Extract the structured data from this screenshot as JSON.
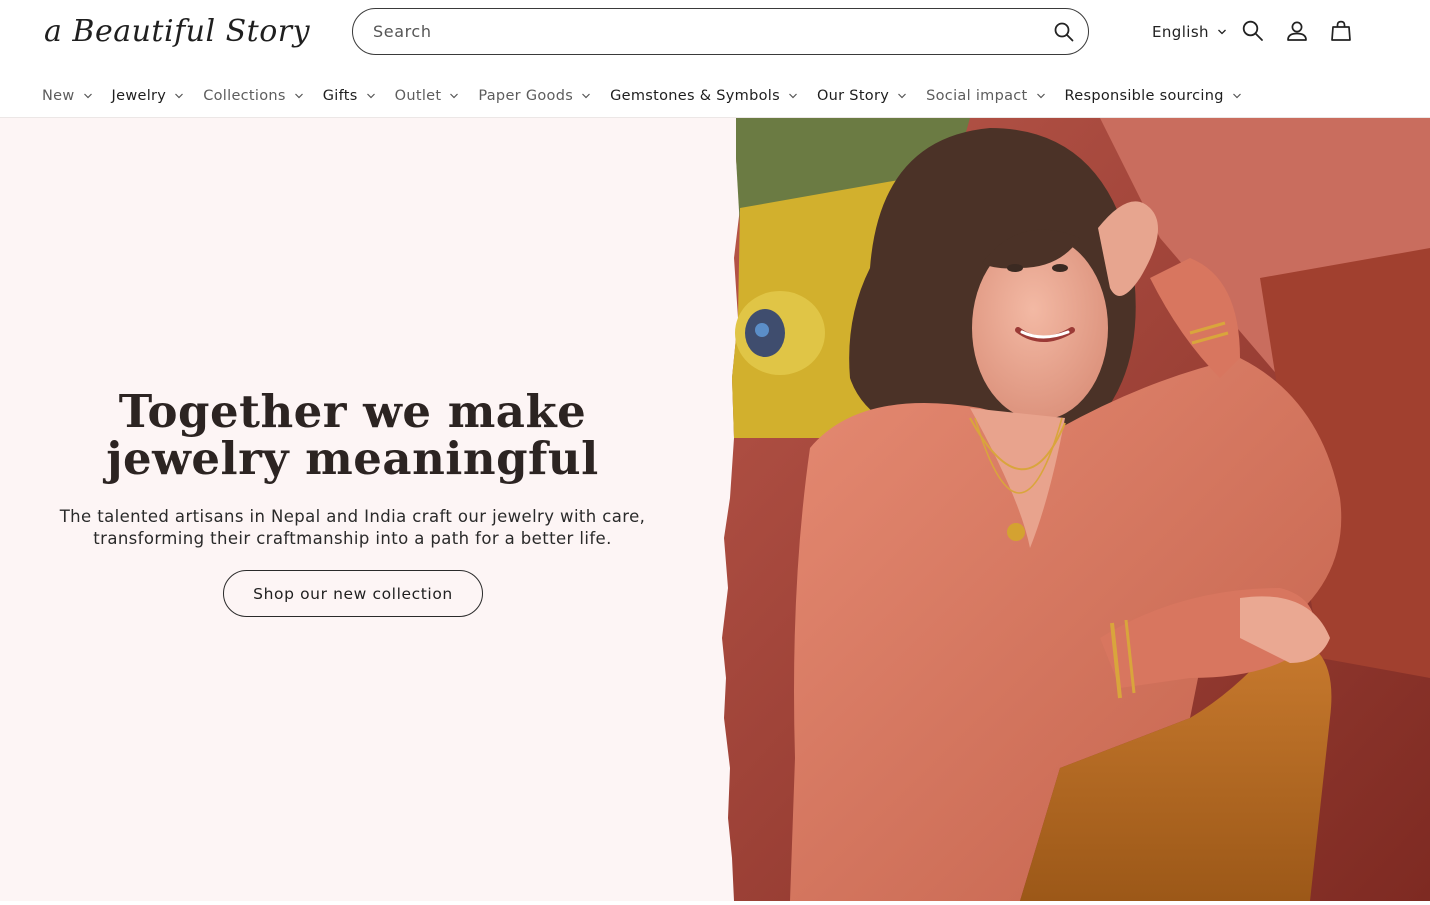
{
  "brand": {
    "logo_text": "a Beautiful Story"
  },
  "search": {
    "placeholder": "Search"
  },
  "header": {
    "language": "English"
  },
  "nav": {
    "items": [
      {
        "label": "New"
      },
      {
        "label": "Jewelry"
      },
      {
        "label": "Collections"
      },
      {
        "label": "Gifts"
      },
      {
        "label": "Outlet"
      },
      {
        "label": "Paper Goods"
      },
      {
        "label": "Gemstones & Symbols"
      },
      {
        "label": "Our Story"
      },
      {
        "label": "Social impact"
      },
      {
        "label": "Responsible sourcing"
      }
    ]
  },
  "hero": {
    "title_line1": "Together we make",
    "title_line2": "jewelry meaningful",
    "subtitle_line1": "The talented artisans in Nepal and India craft our jewelry with care,",
    "subtitle_line2": "transforming their craftmanship into a path for a better life.",
    "cta_label": "Shop our new collection"
  },
  "colors": {
    "hero_background": "#fdf5f5",
    "text_dark": "#2c2422",
    "sweater": "#d8765f",
    "sofa": "#a9483a"
  },
  "icons": [
    "search-icon",
    "chevron-down-icon",
    "user-icon",
    "cart-bag-icon"
  ]
}
